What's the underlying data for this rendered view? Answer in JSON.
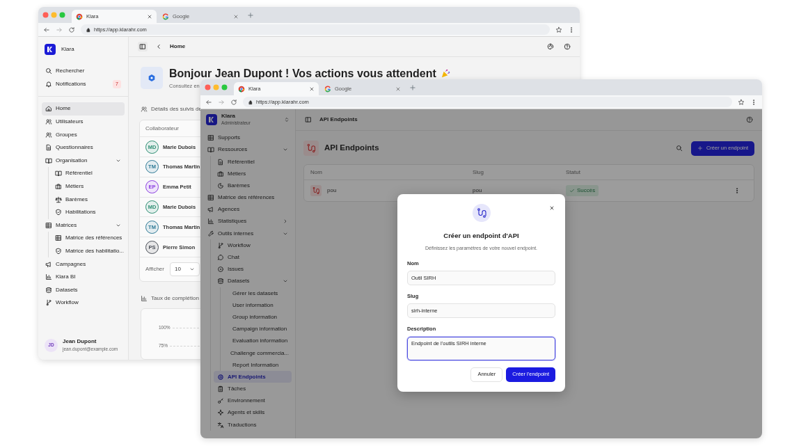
{
  "back_window": {
    "tabs": [
      {
        "title": "Klara",
        "selected": true
      },
      {
        "title": "Google",
        "selected": false
      }
    ],
    "url": "https://app.klarahr.com",
    "sidebar": {
      "brand": "Klara",
      "nav_top": [
        {
          "label": "Rechercher",
          "selected": false
        },
        {
          "label": "Notifications",
          "selected": false,
          "badge": "7"
        }
      ],
      "nav": [
        {
          "label": "Home",
          "selected": true
        },
        {
          "label": "Utilisateurs",
          "selected": false
        },
        {
          "label": "Groupes",
          "selected": false
        },
        {
          "label": "Questionnaires",
          "selected": false
        },
        {
          "label": "Organisation",
          "selected": false,
          "expanded": true,
          "children": [
            {
              "label": "Référentiel",
              "selected": false
            },
            {
              "label": "Métiers",
              "selected": false
            },
            {
              "label": "Barèmes",
              "selected": false
            },
            {
              "label": "Habilitations",
              "selected": false
            }
          ]
        },
        {
          "label": "Matrices",
          "selected": false,
          "expanded": true,
          "children": [
            {
              "label": "Matrice des références",
              "selected": false
            },
            {
              "label": "Matrice des habilitatio...",
              "selected": false
            }
          ]
        },
        {
          "label": "Campagnes",
          "selected": false
        },
        {
          "label": "Klara BI",
          "selected": false
        },
        {
          "label": "Datasets",
          "selected": false
        },
        {
          "label": "Workflow",
          "selected": false
        }
      ],
      "user": {
        "initials": "JD",
        "name": "Jean Dupont",
        "email": "jean.dupont@example.com"
      }
    },
    "header": {
      "page": "Home"
    },
    "greeting": {
      "title": "Bonjour Jean Dupont ! Vos actions vous attendent",
      "subtitle": "Consultez en"
    },
    "section_title": "Détails des suivis de",
    "table": {
      "columns": [
        "Collaborateur"
      ],
      "rows": [
        {
          "initials": "MD",
          "name": "Marie Dubois",
          "color": "#2f8f74"
        },
        {
          "initials": "TM",
          "name": "Thomas Martin",
          "color": "#2f7a96"
        },
        {
          "initials": "EP",
          "name": "Emma Petit",
          "color": "#8b3fe0"
        },
        {
          "initials": "MD",
          "name": "Marie Dubois",
          "color": "#2f8f74"
        },
        {
          "initials": "TM",
          "name": "Thomas Martin",
          "color": "#2f7a96"
        },
        {
          "initials": "PS",
          "name": "Pierre Simon",
          "color": "#4a4f57"
        }
      ]
    },
    "pager": {
      "label": "Afficher",
      "value": "10"
    },
    "chart_title": "Taux de complétion",
    "chart_ticks": [
      "100%",
      "75%"
    ]
  },
  "front_window": {
    "tabs": [
      {
        "title": "Klara",
        "selected": true
      },
      {
        "title": "Google",
        "selected": false
      }
    ],
    "url": "https://app.klarahr.com",
    "sidebar": {
      "brand": "Klara",
      "role": "Administrateur",
      "nav": [
        {
          "label": "Supports",
          "selected": false
        },
        {
          "label": "Ressources",
          "selected": false,
          "expanded": true,
          "children": [
            {
              "label": "Référentiel",
              "selected": false
            },
            {
              "label": "Métiers",
              "selected": false
            },
            {
              "label": "Barèmes",
              "selected": false
            }
          ]
        },
        {
          "label": "Matrice des références",
          "selected": false
        },
        {
          "label": "Agences",
          "selected": false
        },
        {
          "label": "Statistiques",
          "selected": false,
          "expanded": false
        },
        {
          "label": "Outils internes",
          "selected": false,
          "expanded": true,
          "children": [
            {
              "label": "Workflow",
              "selected": false
            },
            {
              "label": "Chat",
              "selected": false
            },
            {
              "label": "Issues",
              "selected": false
            },
            {
              "label": "Datasets",
              "selected": false,
              "expanded": true,
              "children": [
                {
                  "label": "Gérer les datasets",
                  "selected": false
                },
                {
                  "label": "User information",
                  "selected": false
                },
                {
                  "label": "Group information",
                  "selected": false
                },
                {
                  "label": "Campaign information",
                  "selected": false
                },
                {
                  "label": "Evaluation information",
                  "selected": false
                },
                {
                  "label": "Challenge commercia...",
                  "selected": false
                },
                {
                  "label": "Report Information",
                  "selected": false
                }
              ]
            },
            {
              "label": "API Endpoints",
              "selected": true
            },
            {
              "label": "Tâches",
              "selected": false
            },
            {
              "label": "Environnement",
              "selected": false
            },
            {
              "label": "Agents et skills",
              "selected": false
            },
            {
              "label": "Traductions",
              "selected": false
            }
          ]
        }
      ]
    },
    "header": {
      "page": "API Endpoints"
    },
    "page_title": "API Endpoints",
    "create_button": "Créer un endpoint",
    "table": {
      "columns": [
        "Nom",
        "Slug",
        "Statut"
      ],
      "rows": [
        {
          "name": "pou",
          "slug": "pou",
          "status": "Succès"
        }
      ]
    },
    "dialog": {
      "title": "Créer un endpoint d'API",
      "subtitle": "Définissez les paramètres de votre nouvel endpoint.",
      "fields": [
        {
          "kind": "input",
          "label": "Nom",
          "value": "Outil SIRH",
          "focused": false
        },
        {
          "kind": "input",
          "label": "Slug",
          "value": "sirh-interne",
          "focused": false
        },
        {
          "kind": "textarea",
          "label": "Description",
          "value": "Endpoint de l'outils SIRH interne",
          "focused": true
        }
      ],
      "cancel": "Annuler",
      "submit": "Créer l'endpoint"
    }
  }
}
